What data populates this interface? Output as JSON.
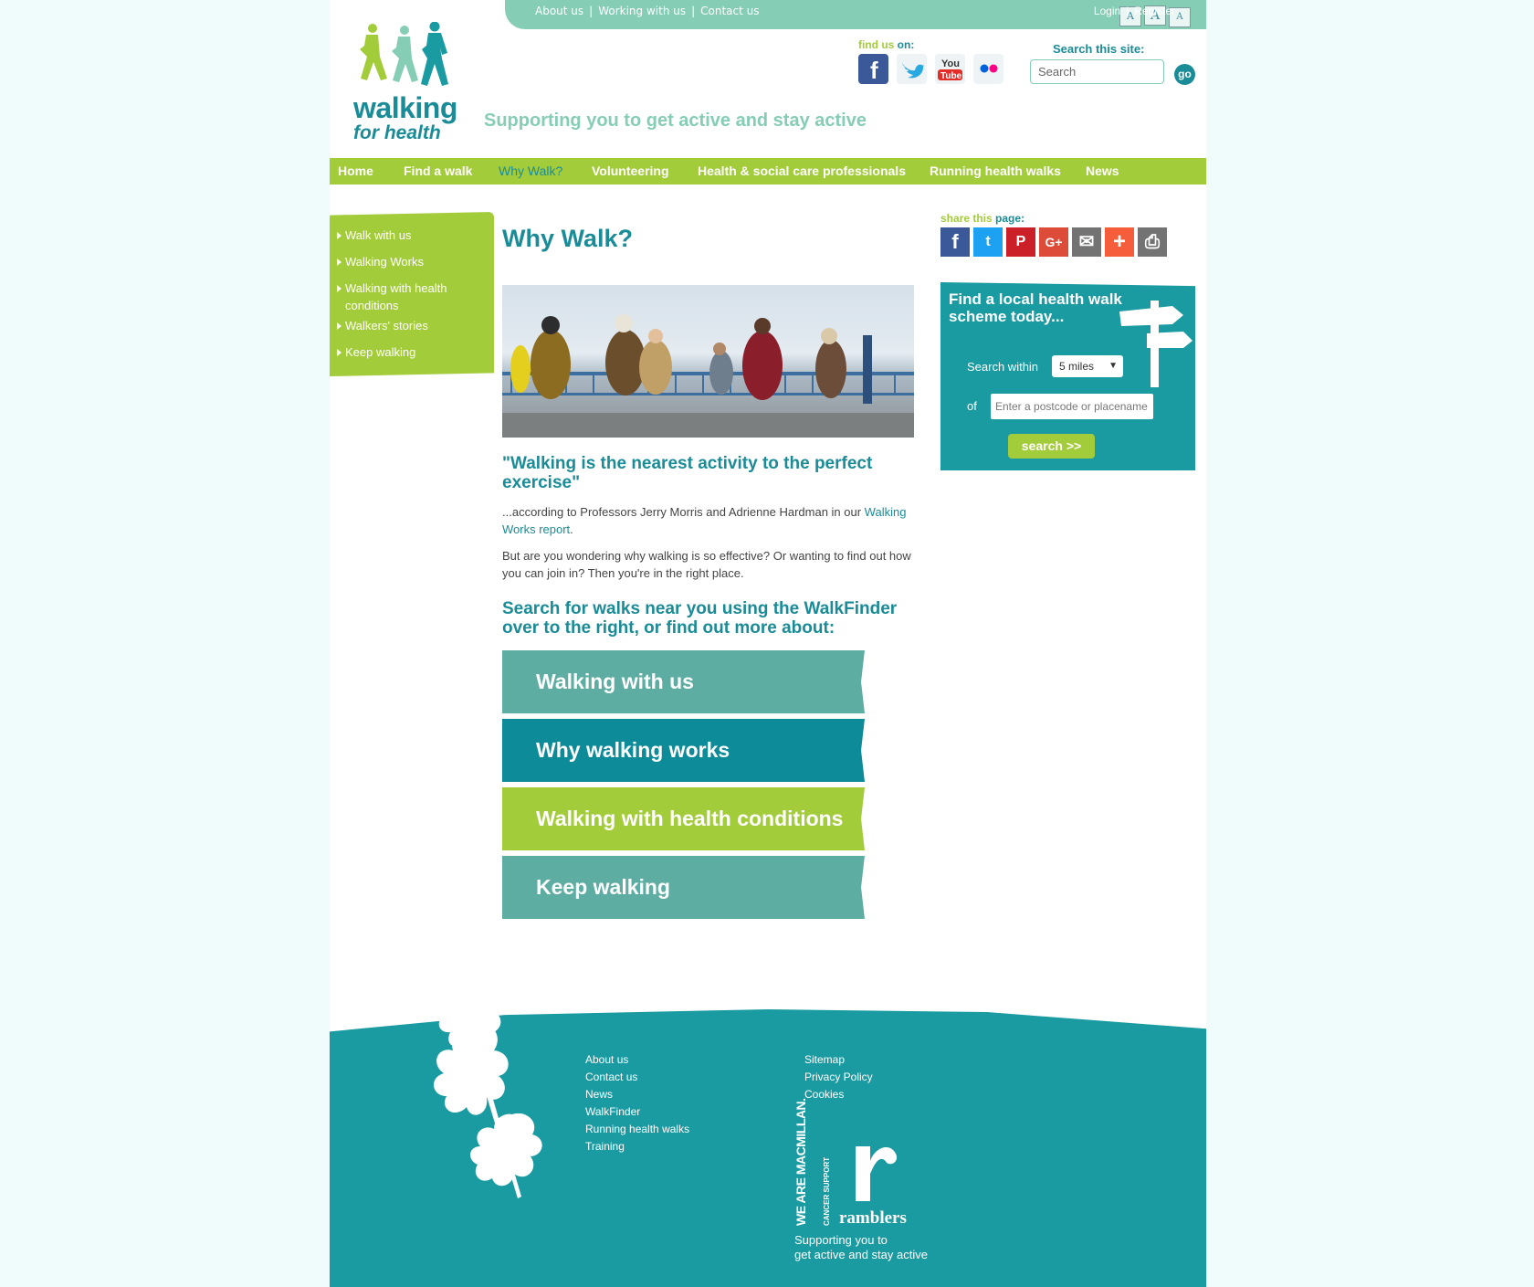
{
  "topbar": {
    "links": [
      "About us",
      "Working with us",
      "Contact us"
    ],
    "separator": "|",
    "font_size_labels": [
      "A",
      "A",
      "A"
    ],
    "login": "Login",
    "register": "Register"
  },
  "logo": {
    "word": "walking",
    "sub": "for health"
  },
  "tagline": "Supporting you to get active and stay active",
  "findus": {
    "part1": "find us",
    "part2": "on:"
  },
  "social_icons": [
    "facebook-icon",
    "twitter-icon",
    "youtube-icon",
    "flickr-icon"
  ],
  "search": {
    "label": "Search this site:",
    "placeholder": "Search",
    "go": "go"
  },
  "nav": {
    "items": [
      "Home",
      "Find a walk",
      "Why Walk?",
      "Volunteering",
      "Health & social care professionals",
      "Running health walks",
      "News"
    ],
    "active": "Why Walk?"
  },
  "sidebar": {
    "items": [
      "Walk with us",
      "Walking Works",
      "Walking with health conditions",
      "Walkers' stories",
      "Keep walking"
    ]
  },
  "main": {
    "title": "Why Walk?",
    "quote": "\"Walking is the nearest activity to the perfect exercise\"",
    "para1_prefix": "...according to Professors Jerry Morris and Adrienne Hardman in our ",
    "para1_link": "Walking Works report",
    "para1_suffix": ".",
    "para2": "But are you wondering why walking is so effective? Or wanting to find out how you can join in? Then you're in the right place.",
    "subhead": "Search for walks near you using the WalkFinder over to the right, or find out more about:",
    "buttons": [
      {
        "label": "Walking with us",
        "color": "#5eada3"
      },
      {
        "label": "Why walking works",
        "color": "#0d8b98"
      },
      {
        "label": "Walking with health conditions",
        "color": "#a3cc3b"
      },
      {
        "label": "Keep walking",
        "color": "#5eada3"
      }
    ]
  },
  "share": {
    "part1": "share this",
    "part2": "page:",
    "icons": [
      {
        "name": "facebook-icon",
        "glyph": "f",
        "color": "#3b5998"
      },
      {
        "name": "twitter-icon",
        "glyph": "t",
        "color": "#1da1f2"
      },
      {
        "name": "pinterest-icon",
        "glyph": "P",
        "color": "#cb2027"
      },
      {
        "name": "google-plus-icon",
        "glyph": "G+",
        "color": "#dd4b39"
      },
      {
        "name": "email-icon",
        "glyph": "✉",
        "color": "#737373"
      },
      {
        "name": "plus-icon",
        "glyph": "+",
        "color": "#f65e3b"
      },
      {
        "name": "print-icon",
        "glyph": "⎙",
        "color": "#737373"
      }
    ]
  },
  "finder": {
    "heading": "Find a local health walk scheme today...",
    "search_within": "Search within",
    "distance": "5 miles",
    "of": "of",
    "postcode_placeholder": "Enter a postcode or placename",
    "button": "search >>"
  },
  "footer": {
    "col1": [
      "About us",
      "Contact us",
      "News",
      "WalkFinder",
      "Running health walks",
      "Training"
    ],
    "col2": [
      "Sitemap",
      "Privacy Policy",
      "Cookies"
    ],
    "macmillan": "WE ARE MACMILLAN.",
    "macmillan_sub": "CANCER SUPPORT",
    "ramblers": "ramblers",
    "tagline_line1": "Supporting you to",
    "tagline_line2": "get active and stay active"
  },
  "colors": {
    "teal": "#1a8c97",
    "mint": "#86cdb5",
    "lime": "#a3cc3b"
  }
}
